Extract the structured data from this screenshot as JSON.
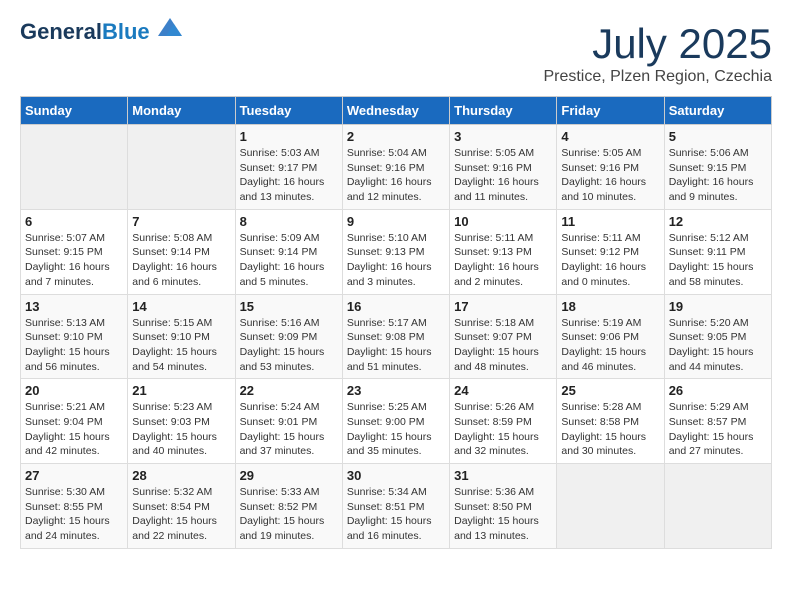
{
  "header": {
    "logo_line1": "General",
    "logo_line2": "Blue",
    "month_title": "July 2025",
    "location": "Prestice, Plzen Region, Czechia"
  },
  "weekdays": [
    "Sunday",
    "Monday",
    "Tuesday",
    "Wednesday",
    "Thursday",
    "Friday",
    "Saturday"
  ],
  "weeks": [
    [
      {
        "day": "",
        "detail": ""
      },
      {
        "day": "",
        "detail": ""
      },
      {
        "day": "1",
        "detail": "Sunrise: 5:03 AM\nSunset: 9:17 PM\nDaylight: 16 hours\nand 13 minutes."
      },
      {
        "day": "2",
        "detail": "Sunrise: 5:04 AM\nSunset: 9:16 PM\nDaylight: 16 hours\nand 12 minutes."
      },
      {
        "day": "3",
        "detail": "Sunrise: 5:05 AM\nSunset: 9:16 PM\nDaylight: 16 hours\nand 11 minutes."
      },
      {
        "day": "4",
        "detail": "Sunrise: 5:05 AM\nSunset: 9:16 PM\nDaylight: 16 hours\nand 10 minutes."
      },
      {
        "day": "5",
        "detail": "Sunrise: 5:06 AM\nSunset: 9:15 PM\nDaylight: 16 hours\nand 9 minutes."
      }
    ],
    [
      {
        "day": "6",
        "detail": "Sunrise: 5:07 AM\nSunset: 9:15 PM\nDaylight: 16 hours\nand 7 minutes."
      },
      {
        "day": "7",
        "detail": "Sunrise: 5:08 AM\nSunset: 9:14 PM\nDaylight: 16 hours\nand 6 minutes."
      },
      {
        "day": "8",
        "detail": "Sunrise: 5:09 AM\nSunset: 9:14 PM\nDaylight: 16 hours\nand 5 minutes."
      },
      {
        "day": "9",
        "detail": "Sunrise: 5:10 AM\nSunset: 9:13 PM\nDaylight: 16 hours\nand 3 minutes."
      },
      {
        "day": "10",
        "detail": "Sunrise: 5:11 AM\nSunset: 9:13 PM\nDaylight: 16 hours\nand 2 minutes."
      },
      {
        "day": "11",
        "detail": "Sunrise: 5:11 AM\nSunset: 9:12 PM\nDaylight: 16 hours\nand 0 minutes."
      },
      {
        "day": "12",
        "detail": "Sunrise: 5:12 AM\nSunset: 9:11 PM\nDaylight: 15 hours\nand 58 minutes."
      }
    ],
    [
      {
        "day": "13",
        "detail": "Sunrise: 5:13 AM\nSunset: 9:10 PM\nDaylight: 15 hours\nand 56 minutes."
      },
      {
        "day": "14",
        "detail": "Sunrise: 5:15 AM\nSunset: 9:10 PM\nDaylight: 15 hours\nand 54 minutes."
      },
      {
        "day": "15",
        "detail": "Sunrise: 5:16 AM\nSunset: 9:09 PM\nDaylight: 15 hours\nand 53 minutes."
      },
      {
        "day": "16",
        "detail": "Sunrise: 5:17 AM\nSunset: 9:08 PM\nDaylight: 15 hours\nand 51 minutes."
      },
      {
        "day": "17",
        "detail": "Sunrise: 5:18 AM\nSunset: 9:07 PM\nDaylight: 15 hours\nand 48 minutes."
      },
      {
        "day": "18",
        "detail": "Sunrise: 5:19 AM\nSunset: 9:06 PM\nDaylight: 15 hours\nand 46 minutes."
      },
      {
        "day": "19",
        "detail": "Sunrise: 5:20 AM\nSunset: 9:05 PM\nDaylight: 15 hours\nand 44 minutes."
      }
    ],
    [
      {
        "day": "20",
        "detail": "Sunrise: 5:21 AM\nSunset: 9:04 PM\nDaylight: 15 hours\nand 42 minutes."
      },
      {
        "day": "21",
        "detail": "Sunrise: 5:23 AM\nSunset: 9:03 PM\nDaylight: 15 hours\nand 40 minutes."
      },
      {
        "day": "22",
        "detail": "Sunrise: 5:24 AM\nSunset: 9:01 PM\nDaylight: 15 hours\nand 37 minutes."
      },
      {
        "day": "23",
        "detail": "Sunrise: 5:25 AM\nSunset: 9:00 PM\nDaylight: 15 hours\nand 35 minutes."
      },
      {
        "day": "24",
        "detail": "Sunrise: 5:26 AM\nSunset: 8:59 PM\nDaylight: 15 hours\nand 32 minutes."
      },
      {
        "day": "25",
        "detail": "Sunrise: 5:28 AM\nSunset: 8:58 PM\nDaylight: 15 hours\nand 30 minutes."
      },
      {
        "day": "26",
        "detail": "Sunrise: 5:29 AM\nSunset: 8:57 PM\nDaylight: 15 hours\nand 27 minutes."
      }
    ],
    [
      {
        "day": "27",
        "detail": "Sunrise: 5:30 AM\nSunset: 8:55 PM\nDaylight: 15 hours\nand 24 minutes."
      },
      {
        "day": "28",
        "detail": "Sunrise: 5:32 AM\nSunset: 8:54 PM\nDaylight: 15 hours\nand 22 minutes."
      },
      {
        "day": "29",
        "detail": "Sunrise: 5:33 AM\nSunset: 8:52 PM\nDaylight: 15 hours\nand 19 minutes."
      },
      {
        "day": "30",
        "detail": "Sunrise: 5:34 AM\nSunset: 8:51 PM\nDaylight: 15 hours\nand 16 minutes."
      },
      {
        "day": "31",
        "detail": "Sunrise: 5:36 AM\nSunset: 8:50 PM\nDaylight: 15 hours\nand 13 minutes."
      },
      {
        "day": "",
        "detail": ""
      },
      {
        "day": "",
        "detail": ""
      }
    ]
  ]
}
